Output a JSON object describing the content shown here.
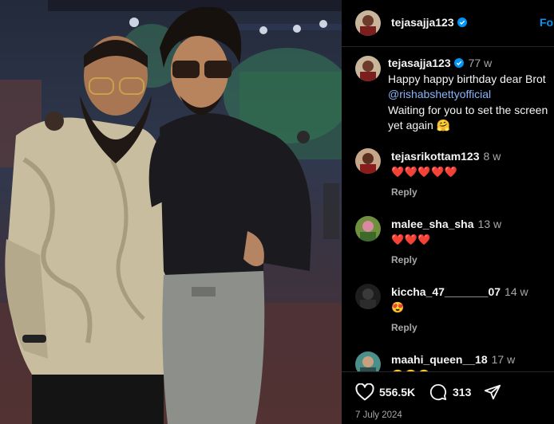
{
  "post": {
    "author": "tejasajja123",
    "follow_label": "Fo",
    "photo_alt": "Two men posing together at a stage event",
    "date": "7 July 2024"
  },
  "caption": {
    "author": "tejasajja123",
    "time": "77 w",
    "line1": "Happy happy birthday dear Brot",
    "mention": "@rishabshettyofficial",
    "line3": "Waiting for you to set the screen",
    "line4": "yet again 🤗"
  },
  "comments": [
    {
      "user": "tejasrikottam123",
      "time": "8 w",
      "text": "❤️❤️❤️❤️❤️",
      "reply": "Reply"
    },
    {
      "user": "malee_sha_sha",
      "time": "13 w",
      "text": "❤️❤️❤️",
      "reply": "Reply"
    },
    {
      "user": "kiccha_47_______07",
      "time": "14 w",
      "text": "😍",
      "reply": "Reply"
    },
    {
      "user": "maahi_queen__18",
      "time": "17 w",
      "text": "😊😊😊",
      "reply": ""
    }
  ],
  "actions": {
    "likes": "556.5K",
    "comments": "313"
  },
  "colors": {
    "background": "#000000",
    "link": "#0095f6",
    "heart_red": "#ed4956",
    "muted": "#a8a8a8"
  }
}
